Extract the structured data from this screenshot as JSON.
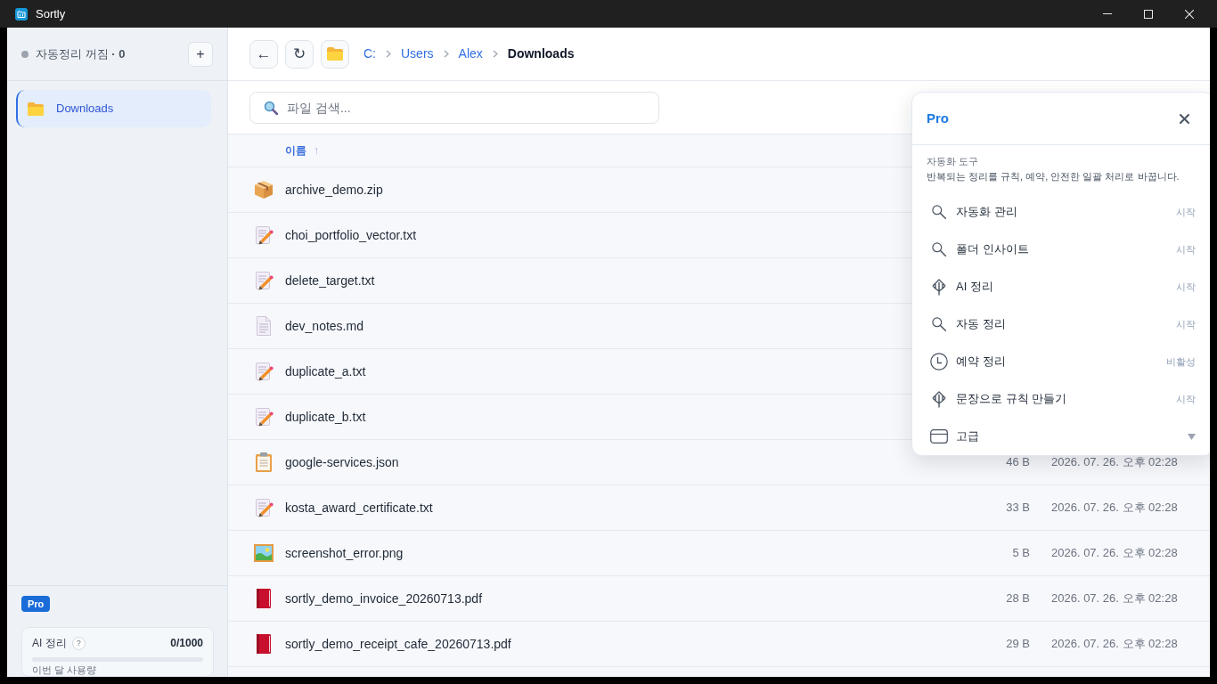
{
  "window": {
    "title": "Sortly"
  },
  "sidebar": {
    "status": {
      "on": false,
      "label": "자동정리 꺼짐 **· 0**"
    },
    "add_button": "+",
    "items": [
      {
        "label": "Downloads",
        "selected": true
      }
    ],
    "plan_badge": "Pro",
    "usage": {
      "title": "AI 정리",
      "help": "?",
      "count": "0/1000",
      "level": 0,
      "caption": "이번 달 사용량"
    }
  },
  "toolbar": {
    "back": "←",
    "refresh": "↻",
    "breadcrumb": [
      {
        "label": "C:",
        "current": false
      },
      {
        "label": "Users",
        "current": false
      },
      {
        "label": "Alex",
        "current": false
      },
      {
        "label": "Downloads",
        "current": true
      }
    ]
  },
  "search": {
    "placeholder": "파일 검색..."
  },
  "table": {
    "columns": [
      {
        "label": "이름",
        "sort": "↑"
      }
    ],
    "rows": [
      {
        "kind": "zip",
        "name": "archive_demo.zip"
      },
      {
        "kind": "txt",
        "name": "choi_portfolio_vector.txt"
      },
      {
        "kind": "txt",
        "name": "delete_target.txt"
      },
      {
        "kind": "md",
        "name": "dev_notes.md"
      },
      {
        "kind": "txt",
        "name": "duplicate_a.txt"
      },
      {
        "kind": "txt",
        "name": "duplicate_b.txt"
      },
      {
        "kind": "json",
        "name": "google-services.json",
        "size": "46 B",
        "modified": "2026. 07. 26. 오후 02:28"
      },
      {
        "kind": "txt",
        "name": "kosta_award_certificate.txt",
        "size": "33 B",
        "modified": "2026. 07. 26. 오후 02:28"
      },
      {
        "kind": "png",
        "name": "screenshot_error.png",
        "size": "5 B",
        "modified": "2026. 07. 26. 오후 02:28"
      },
      {
        "kind": "pdf",
        "name": "sortly_demo_invoice_20260713.pdf",
        "size": "28 B",
        "modified": "2026. 07. 26. 오후 02:28"
      },
      {
        "kind": "pdf",
        "name": "sortly_demo_receipt_cafe_20260713.pdf",
        "size": "29 B",
        "modified": "2026. 07. 26. 오후 02:28"
      }
    ]
  },
  "popup": {
    "title": "Pro",
    "section": "자동화 도구",
    "description": "반복되는 정리를 규칙, 예약, 안전한 일괄 처리로 바꿉니다.",
    "items": [
      {
        "kind": "action",
        "label": "자동화 관리",
        "status": "시작"
      },
      {
        "kind": "action",
        "label": "폴더 인사이트",
        "status": "시작"
      },
      {
        "kind": "action",
        "label": "AI 정리",
        "status": "시작"
      },
      {
        "kind": "action",
        "label": "자동 정리",
        "status": "시작"
      },
      {
        "kind": "action",
        "label": "예약 정리",
        "status": "비활성"
      },
      {
        "kind": "action",
        "label": "문장으로 규칙 만들기",
        "status": "시작"
      },
      {
        "kind": "group",
        "label": "고급",
        "expanded": false
      }
    ]
  }
}
